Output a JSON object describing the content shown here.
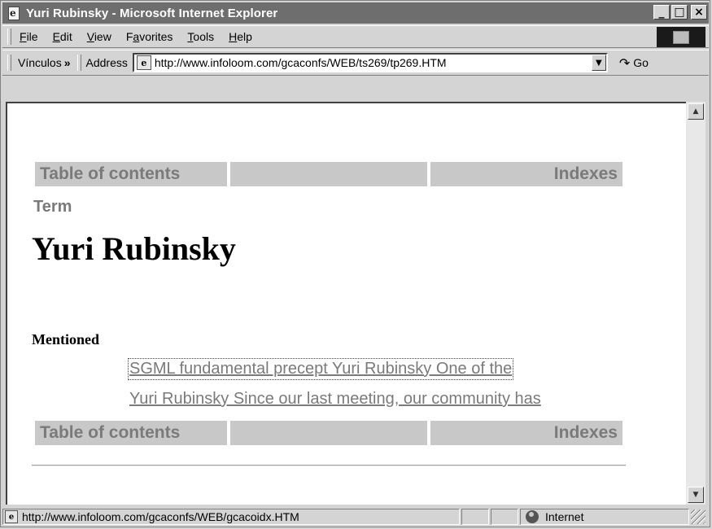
{
  "window": {
    "title": "Yuri Rubinsky - Microsoft Internet Explorer",
    "controls": {
      "minimize": "_",
      "maximize": "□",
      "close": "×"
    }
  },
  "menubar": {
    "items": [
      {
        "underline": "F",
        "rest": "ile"
      },
      {
        "underline": "E",
        "rest": "dit"
      },
      {
        "underline": "V",
        "rest": "iew"
      },
      {
        "pre": "F",
        "underline": "a",
        "rest": "vorites"
      },
      {
        "underline": "T",
        "rest": "ools"
      },
      {
        "underline": "H",
        "rest": "elp"
      }
    ]
  },
  "addressbar": {
    "links_label": "Vínculos",
    "links_chevron": "»",
    "address_label": "Address",
    "url": "http://www.infoloom.com/gcaconfs/WEB/ts269/tp269.HTM",
    "go_label": "Go"
  },
  "page": {
    "nav": {
      "toc": "Table of contents",
      "indexes": "Indexes"
    },
    "term_label": "Term",
    "term_title": "Yuri Rubinsky",
    "mentioned_label": "Mentioned",
    "references": [
      "SGML fundamental precept Yuri Rubinsky One of the",
      "Yuri Rubinsky Since our last meeting, our community has"
    ]
  },
  "statusbar": {
    "url": "http://www.infoloom.com/gcaconfs/WEB/gcacoidx.HTM",
    "zone": "Internet"
  },
  "icons": {
    "ie_logo": "ie-logo-icon",
    "page": "page-icon",
    "globe": "globe-icon",
    "go": "go-arrow-icon"
  }
}
